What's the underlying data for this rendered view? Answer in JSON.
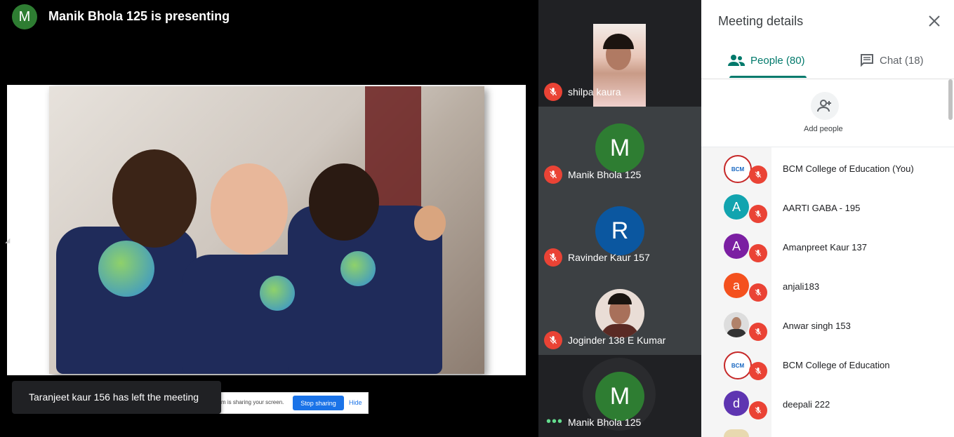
{
  "presenter": {
    "avatar_letter": "M",
    "title": "Manik Bhola 125 is presenting"
  },
  "share_bar": {
    "text": "m is sharing your screen.",
    "stop_label": "Stop sharing",
    "hide_label": "Hide"
  },
  "toast": {
    "text": "Taranjeet kaur 156 has left the meeting"
  },
  "tiles": [
    {
      "name": "shilpa kaura"
    },
    {
      "name": "Manik Bhola 125",
      "letter": "M",
      "color": "#2e7d32"
    },
    {
      "name": "Ravinder Kaur 157",
      "letter": "R",
      "color": "#0b57a0"
    },
    {
      "name": "Joginder 138 E Kumar"
    },
    {
      "name": "Manik Bhola 125",
      "letter": "M",
      "color": "#2e7d32"
    }
  ],
  "panel": {
    "title": "Meeting details",
    "tab_people": "People (80)",
    "tab_chat": "Chat (18)",
    "add_people": "Add people",
    "logo_text": "BCM"
  },
  "people": [
    {
      "name": "BCM College of Education (You)",
      "avatar": "logo"
    },
    {
      "name": "AARTI GABA - 195",
      "letter": "A",
      "color": "#12a4af"
    },
    {
      "name": "Amanpreet Kaur 137",
      "letter": "A",
      "color": "#7b1fa2"
    },
    {
      "name": "anjali183",
      "letter": "a",
      "color": "#f4511e"
    },
    {
      "name": "Anwar singh 153",
      "avatar": "photo"
    },
    {
      "name": "BCM College of Education",
      "avatar": "logo"
    },
    {
      "name": "deepali 222",
      "letter": "d",
      "color": "#5e35b1"
    }
  ],
  "colors": {
    "accent": "#00796b",
    "mic_off": "#ea4335",
    "stop_button": "#1a73e8"
  }
}
